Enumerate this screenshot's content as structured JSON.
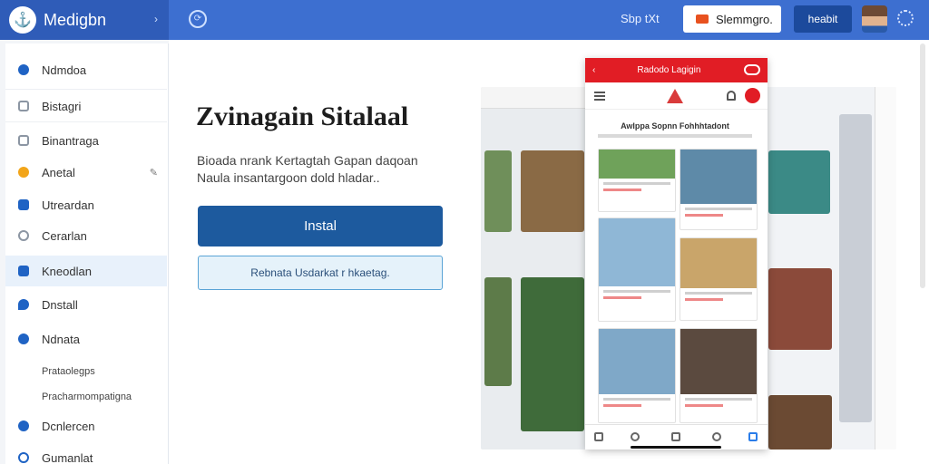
{
  "topbar": {
    "brand_name": "Medigbn",
    "sign_link": "Sbp tXt",
    "language_button": "Slemmgro.",
    "login_button": "heabit"
  },
  "sidebar": {
    "items": [
      {
        "label": "Ndmdoa",
        "icon": "grid-icon",
        "color": "#1f63c4"
      },
      {
        "label": "Bistagri",
        "icon": "document-icon",
        "color": "#8c96a3"
      },
      {
        "label": "Binantraga",
        "icon": "list-icon",
        "color": "#8c96a3"
      },
      {
        "label": "Anetal",
        "icon": "star-icon",
        "color": "#f2a51a"
      },
      {
        "label": "Utreardan",
        "icon": "calendar-icon",
        "color": "#1f63c4"
      },
      {
        "label": "Cerarlan",
        "icon": "clock-icon",
        "color": "#8c96a3"
      },
      {
        "label": "Kneodlan",
        "icon": "folder-icon",
        "color": "#1f63c4"
      },
      {
        "label": "Dnstall",
        "icon": "shield-icon",
        "color": "#1f63c4"
      },
      {
        "label": "Ndnata",
        "icon": "globe-icon",
        "color": "#1f63c4"
      },
      {
        "label": "Dcnlercen",
        "icon": "circle-icon",
        "color": "#1f63c4"
      },
      {
        "label": "Gumanlat",
        "icon": "info-icon",
        "color": "#1f63c4"
      }
    ],
    "sub_items": [
      "Prataolegps",
      "Pracharmompatigna"
    ]
  },
  "main": {
    "title": "Zvinagain Sitalaal",
    "description": "Bioada nrank Kertagtah Gapan daqoan Naula insantargoon dold hladar..",
    "install_button": "Instal",
    "learn_button": "Rebnata Usdarkat r hkaetag.",
    "phone": {
      "header_title": "Radodo Lagigin",
      "section_title": "Awlppa Sopnn Fohhhtadont"
    }
  },
  "colors": {
    "topbar": "#3d6fd0",
    "brand": "#2f5cb8",
    "install": "#1d5a9e",
    "accent_red": "#e11d25"
  }
}
